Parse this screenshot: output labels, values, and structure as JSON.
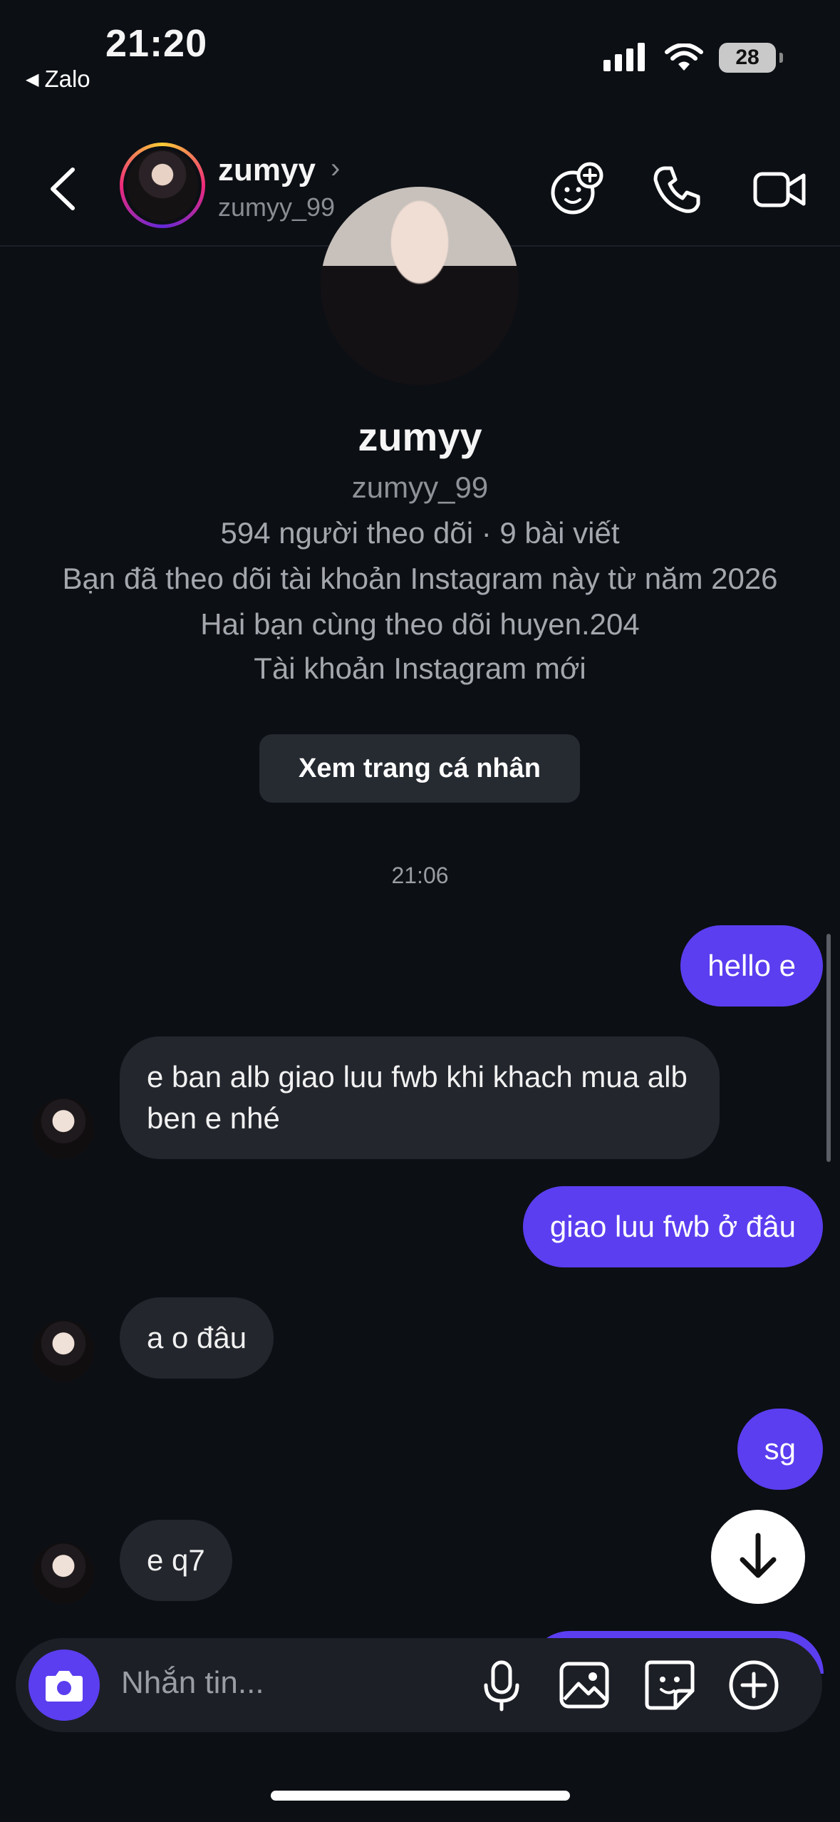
{
  "status_bar": {
    "time": "21:20",
    "back_app": "Zalo",
    "battery": "28"
  },
  "header": {
    "name": "zumyy",
    "username": "zumyy_99"
  },
  "profile": {
    "name": "zumyy",
    "username": "zumyy_99",
    "stats": "594 người theo dõi · 9 bài viết",
    "followed_since": "Bạn đã theo dõi tài khoản Instagram này từ năm 2026",
    "mutual": "Hai bạn cùng theo dõi huyen.204",
    "new_account": "Tài khoản Instagram mới",
    "view_profile_label": "Xem trang cá nhân"
  },
  "timestamp": "21:06",
  "messages": [
    {
      "from": "me",
      "text": "hello e"
    },
    {
      "from": "them",
      "text": "e ban alb giao luu fwb khi khach mua alb ben e nhé"
    },
    {
      "from": "me",
      "text": "giao luu fwb ở đâu"
    },
    {
      "from": "them",
      "text": "a o đâu"
    },
    {
      "from": "me",
      "text": "sg"
    },
    {
      "from": "them",
      "text": "e q7"
    }
  ],
  "composer": {
    "placeholder": "Nhắn tin..."
  },
  "colors": {
    "outgoing": "#5b3ef0",
    "incoming": "#23262d",
    "background": "#0c0f14"
  }
}
